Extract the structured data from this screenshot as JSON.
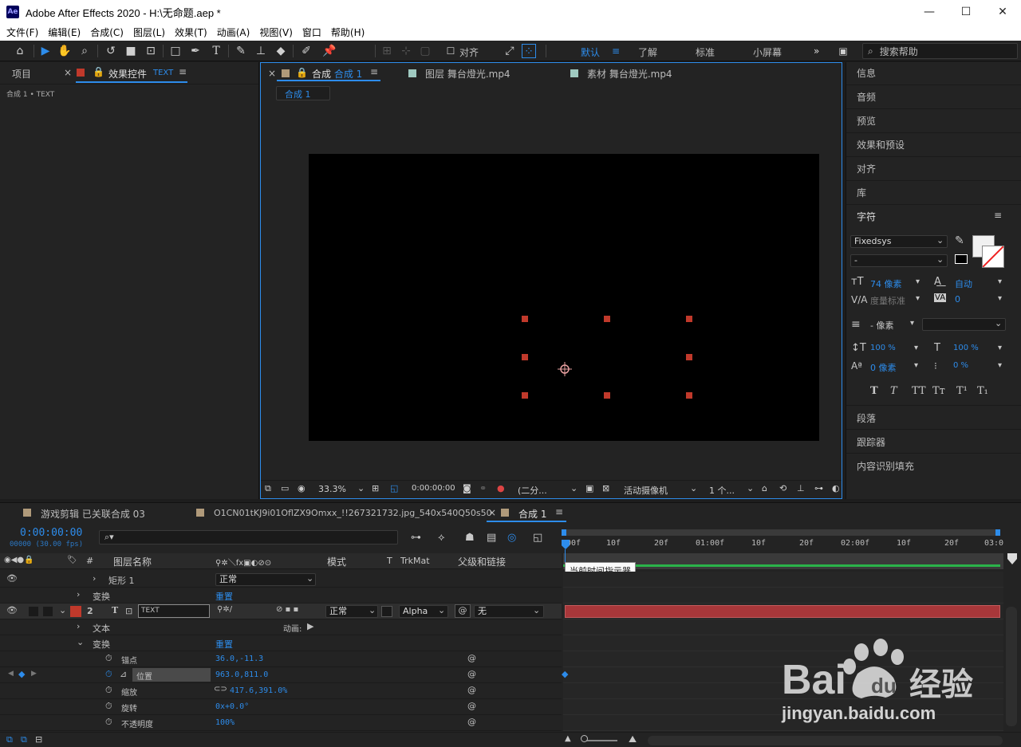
{
  "window": {
    "title": "Adobe After Effects 2020 - H:\\无命题.aep *",
    "logo": "Ae"
  },
  "menu": [
    "文件(F)",
    "编辑(E)",
    "合成(C)",
    "图层(L)",
    "效果(T)",
    "动画(A)",
    "视图(V)",
    "窗口",
    "帮助(H)"
  ],
  "toolbar": {
    "align_label": "对齐",
    "workspaces": [
      "默认",
      "了解",
      "标准",
      "小屏幕"
    ],
    "active_workspace": "默认",
    "search_placeholder": "搜索帮助"
  },
  "left_panel": {
    "tab_project": "项目",
    "tab_effects": "效果控件",
    "tab_effects_layer": "TEXT",
    "breadcrumb": "合成 1 • TEXT"
  },
  "comp_panel": {
    "tab_comp_prefix": "合成",
    "tab_comp_name": "合成 1",
    "tab_layer": "图层 舞台燈光.mp4",
    "tab_footage": "素材 舞台燈光.mp4",
    "crumb": "合成 1",
    "footer": {
      "zoom": "33.3%",
      "timecode": "0:00:00:00",
      "resolution": "(二分...",
      "camera": "活动摄像机",
      "views": "1 个..."
    }
  },
  "right_panel": {
    "items_top": [
      "信息",
      "音频",
      "预览",
      "效果和预设",
      "对齐",
      "库"
    ],
    "character": {
      "title": "字符",
      "font": "Fixedsys",
      "style": "-",
      "size": "74 像素",
      "leading": "自动",
      "kerning": "度量标准",
      "tracking": "0",
      "stroke_width": "- 像素",
      "vscale": "100 %",
      "hscale": "100 %",
      "baseline": "0 像素",
      "tsume": "0 %",
      "styles": [
        "T",
        "T",
        "TT",
        "Tт",
        "T¹",
        "T₁"
      ]
    },
    "items_bottom": [
      "段落",
      "跟踪器",
      "内容识别填充"
    ]
  },
  "timeline": {
    "tabs": [
      {
        "label": "游戏剪辑 已关联合成 03",
        "color": "#b09a7a"
      },
      {
        "label": "O1CN01tKJ9i01OflZX9Omxx_!!267321732.jpg_540x540Q50s50",
        "color": "#b09a7a"
      },
      {
        "label": "合成 1",
        "color": "#b09a7a"
      }
    ],
    "timecode": "0:00:00:00",
    "frames": "00000 (30.00 fps)",
    "columns": {
      "layer_name": "图层名称",
      "mode": "模式",
      "t": "T",
      "trkmat": "TrkMat",
      "parent": "父级和链接"
    },
    "ruler": [
      "00f",
      "10f",
      "20f",
      "01:00f",
      "10f",
      "20f",
      "02:00f",
      "10f",
      "20f",
      "03:0"
    ],
    "tooltip": "当前时间指示器",
    "layer1": {
      "name": "矩形 1",
      "mode": "正常",
      "transform": "变换",
      "reset": "重置"
    },
    "layer2": {
      "index": "2",
      "name": "TEXT",
      "mode": "正常",
      "trkmat": "Alpha",
      "parent": "无",
      "text_group": "文本",
      "animate": "动画:",
      "transform": "变换",
      "reset": "重置",
      "props": [
        {
          "name": "锚点",
          "value": "36.0,-11.3"
        },
        {
          "name": "位置",
          "value": "963.0,811.0"
        },
        {
          "name": "缩放",
          "value": "417.6,391.0%"
        },
        {
          "name": "旋转",
          "value": "0x+0.0°"
        },
        {
          "name": "不透明度",
          "value": "100%"
        }
      ]
    }
  },
  "watermark": {
    "brand": "Bai du 经验",
    "url": "jingyan.baidu.com"
  }
}
